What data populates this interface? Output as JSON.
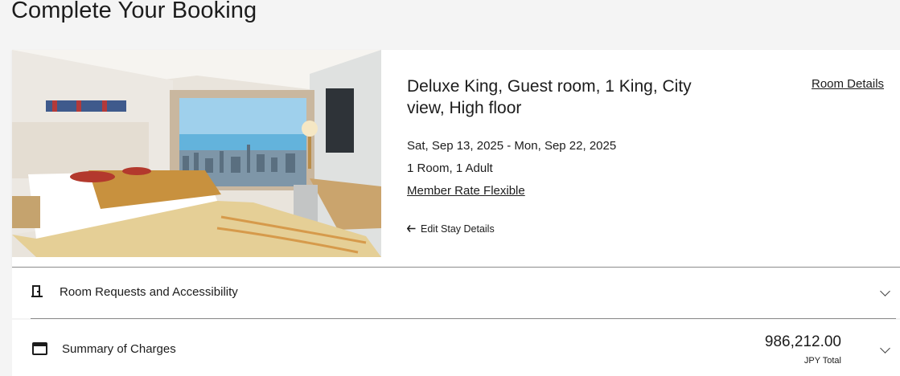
{
  "page": {
    "title": "Complete Your Booking"
  },
  "room": {
    "name": "Deluxe King, Guest room, 1 King, City view, High floor",
    "details_link": "Room Details",
    "dates": "Sat, Sep 13, 2025 - Mon, Sep 22, 2025",
    "occupancy": "1 Room, 1 Adult",
    "rate": "Member Rate Flexible",
    "edit_stay": "Edit Stay Details",
    "edit_stay_icon": "arrow-left-icon",
    "photo": "hotel-room-photo"
  },
  "requests": {
    "label": "Room Requests and Accessibility",
    "icon": "door-icon",
    "expand_icon": "chevron-down-icon"
  },
  "charges": {
    "label": "Summary of Charges",
    "icon": "wallet-icon",
    "amount": "986,212.00",
    "unit": "JPY Total",
    "expand_icon": "chevron-down-icon"
  }
}
